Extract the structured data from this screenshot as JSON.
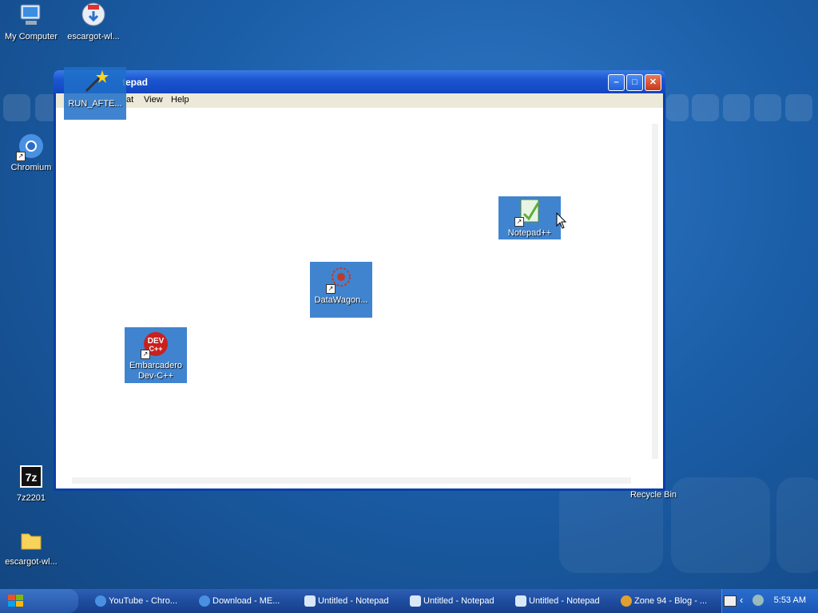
{
  "desktop": {
    "icons": [
      {
        "label": "My Computer"
      },
      {
        "label": "escargot-wl..."
      },
      {
        "label": "RUN_AFTE..."
      },
      {
        "label": "Chromium"
      },
      {
        "label": "Notepad++"
      },
      {
        "label": "DataWagon..."
      },
      {
        "label": "Embarcadero Dev-C++"
      },
      {
        "label": "7z2201"
      },
      {
        "label": "escargot-wl..."
      },
      {
        "label": "Recycle Bin"
      }
    ]
  },
  "window": {
    "title": "Notepad",
    "title_visible": "tepad",
    "menu": [
      "at",
      "View",
      "Help"
    ],
    "buttons": {
      "minimize": "–",
      "maximize": "□",
      "close": "✕"
    }
  },
  "taskbar": {
    "start_label": "",
    "tasks": [
      {
        "label": "YouTube - Chro...",
        "icon": "chromium-icon"
      },
      {
        "label": "Download - ME...",
        "icon": "chromium-icon"
      },
      {
        "label": "Untitled - Notepad",
        "icon": "notepad-icon"
      },
      {
        "label": "Untitled - Notepad",
        "icon": "notepad-icon"
      },
      {
        "label": "Untitled - Notepad",
        "icon": "notepad-icon"
      },
      {
        "label": "Zone 94 - Blog - ...",
        "icon": "browser-icon"
      }
    ],
    "clock": "5:53 AM"
  }
}
